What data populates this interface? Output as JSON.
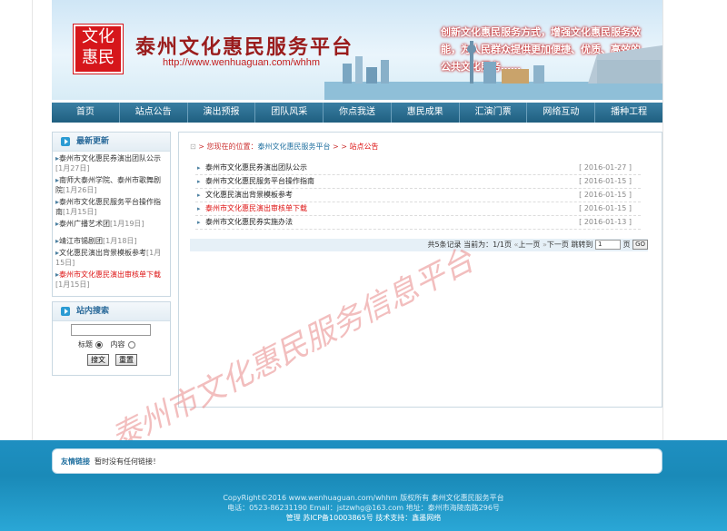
{
  "header": {
    "logo_text": "文化惠民",
    "site_title": "泰州文化惠民服务平台",
    "url": "http://www.wenhuaguan.com/whhm",
    "slogan": "创新文化惠民服务方式，增强文化惠民服务效能，为人民群众提供更加便捷、优质、高效的公共文化服务……"
  },
  "nav": [
    "首页",
    "站点公告",
    "演出预报",
    "团队风采",
    "你点我送",
    "惠民成果",
    "汇演门票",
    "网络互动",
    "播种工程"
  ],
  "sidebar": {
    "latest_title": "最新更新",
    "latest_items": [
      {
        "title": "泰州市文化惠民券演出团队公示",
        "date": "[1月27日]",
        "red": false
      },
      {
        "title": "南师大泰州学院、泰州市歌舞剧院",
        "date": "[1月26日]",
        "red": false
      },
      {
        "title": "泰州市文化惠民服务平台操作指南",
        "date": "[1月15日]",
        "red": false
      },
      {
        "title": "泰州广播艺术团",
        "date": "[1月19日]",
        "red": false
      },
      {
        "title": "靖江市锡剧团",
        "date": "[1月18日]",
        "red": false
      },
      {
        "title": "文化惠民演出背景模板参考",
        "date": "[1月15日]",
        "red": false
      },
      {
        "title": "泰州市文化惠民演出审核单下载",
        "date": "[1月15日]",
        "red": true
      }
    ],
    "search_title": "站内搜索",
    "search_value": "",
    "radio_title": "标题",
    "radio_content": "内容",
    "search_button": "搜文",
    "reset_button": "重置"
  },
  "main": {
    "crumb_lead": "您现在的位置：",
    "crumb_site": "泰州文化惠民服务平台",
    "crumb_sep": " > > ",
    "crumb_current": "站点公告",
    "articles": [
      {
        "title": "泰州市文化惠民券演出团队公示",
        "date": "[ 2016-01-27 ]",
        "red": false
      },
      {
        "title": "泰州市文化惠民服务平台操作指南",
        "date": "[ 2016-01-15 ]",
        "red": false
      },
      {
        "title": "文化惠民演出背景模板参考",
        "date": "[ 2016-01-15 ]",
        "red": false
      },
      {
        "title": "泰州市文化惠民演出审核单下载",
        "date": "[ 2016-01-15 ]",
        "red": true
      },
      {
        "title": "泰州市文化惠民券实施办法",
        "date": "[ 2016-01-13 ]",
        "red": false
      }
    ],
    "pager": {
      "summary": "共5条记录 当前为：1/1页",
      "prev": "上一页",
      "next": "下一页",
      "jump": "跳转到",
      "page_value": "1",
      "page_unit": "页",
      "go": "GO"
    }
  },
  "watermark": "泰州市文化惠民服务信息平台",
  "friends": {
    "label": "友情链接",
    "text": "暂时没有任何链接！"
  },
  "footer": {
    "copyright": "CopyRight©2016 www.wenhuaguan.com/whhm 版权所有 泰州文化惠民服务平台",
    "contact": "电话：0523-86231190 Email：jstzwhg@163.com    地址：泰州市海陵南路296号",
    "icp": "管理 苏ICP备10003865号 技术支持：鑫墨网络"
  },
  "colors": {
    "brand_red": "#d6161b",
    "nav_blue": "#1f5f80",
    "footer_blue": "#1e8fc1"
  }
}
